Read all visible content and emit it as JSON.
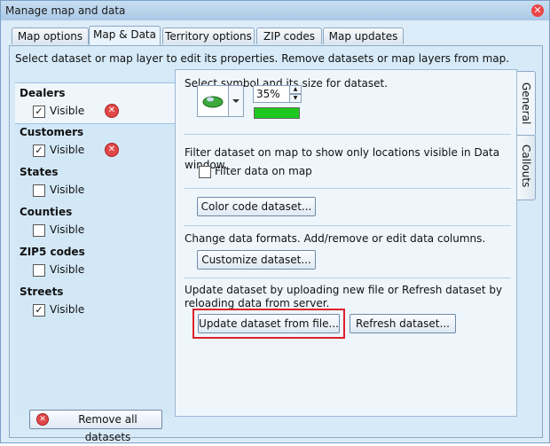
{
  "window": {
    "title": "Manage map and data"
  },
  "tabs": [
    {
      "label": "Map options"
    },
    {
      "label": "Map & Data"
    },
    {
      "label": "Territory options"
    },
    {
      "label": "ZIP codes"
    },
    {
      "label": "Map updates"
    }
  ],
  "instructions": "Select dataset or map layer to edit its properties. Remove datasets or map layers from map.",
  "layers": [
    {
      "name": "Dealers",
      "visible_label": "Visible",
      "checked": true
    },
    {
      "name": "Customers",
      "visible_label": "Visible",
      "checked": true
    },
    {
      "name": "States",
      "visible_label": "Visible",
      "checked": false
    },
    {
      "name": "Counties",
      "visible_label": "Visible",
      "checked": false
    },
    {
      "name": "ZIP5 codes",
      "visible_label": "Visible",
      "checked": false
    },
    {
      "name": "Streets",
      "visible_label": "Visible",
      "checked": true
    }
  ],
  "symbol_section": {
    "text": "Select symbol and its size for dataset.",
    "size": "35%",
    "color": "#1ec81e"
  },
  "filter_section": {
    "text": "Filter dataset on map to show only locations visible in Data window.",
    "checkbox_label": "Filter data on map"
  },
  "color_code_button": "Color code dataset...",
  "formats_section": {
    "text": "Change data formats. Add/remove or edit data columns.",
    "button": "Customize dataset..."
  },
  "update_section": {
    "line1": "Update dataset by uploading new file or Refresh dataset by",
    "line2": "reloading data from server.",
    "update_button": "Update dataset from file...",
    "refresh_button": "Refresh dataset..."
  },
  "side_tabs": [
    {
      "label": "General"
    },
    {
      "label": "Callouts"
    }
  ],
  "remove_all_button": "Remove all datasets",
  "icons": {
    "close": "close-icon",
    "remove": "remove-icon",
    "car": "car-symbol-icon"
  }
}
